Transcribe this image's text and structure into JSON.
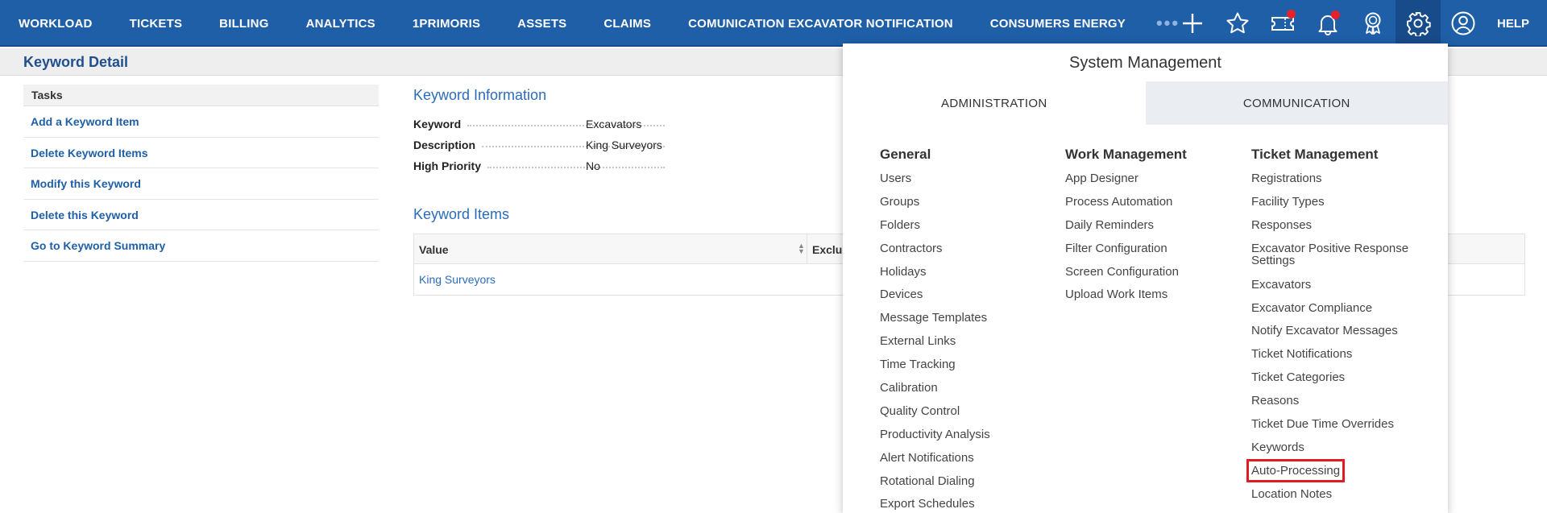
{
  "topnav": {
    "items": [
      "WORKLOAD",
      "TICKETS",
      "BILLING",
      "ANALYTICS",
      "1PRIMORIS",
      "ASSETS",
      "CLAIMS",
      "COMUNICATION EXCAVATOR NOTIFICATION",
      "CONSUMERS ENERGY"
    ],
    "more": "•••",
    "help": "HELP",
    "icons": [
      "plus-icon",
      "star-icon",
      "ticket-icon",
      "bell-icon",
      "award-icon",
      "gear-icon",
      "user-icon"
    ],
    "colors": {
      "bar": "#1f5fa8",
      "badge": "#e8202a"
    }
  },
  "page": {
    "title": "Keyword Detail"
  },
  "tasks": {
    "header": "Tasks",
    "links": [
      "Add a Keyword Item",
      "Delete Keyword Items",
      "Modify this Keyword",
      "Delete this Keyword",
      "Go to Keyword Summary"
    ]
  },
  "keyword_info": {
    "title": "Keyword Information",
    "rows": [
      {
        "label": "Keyword",
        "value": "Excavators"
      },
      {
        "label": "Description",
        "value": "King Surveyors"
      },
      {
        "label": "High Priority",
        "value": "No"
      }
    ]
  },
  "keyword_items": {
    "title": "Keyword Items",
    "columns": [
      "Value",
      "Exclus"
    ],
    "rows": [
      {
        "value": "King Surveyors"
      }
    ]
  },
  "system_management": {
    "title": "System Management",
    "tabs": [
      {
        "label": "ADMINISTRATION",
        "active": true
      },
      {
        "label": "COMMUNICATION",
        "active": false
      }
    ],
    "columns": [
      {
        "heading": "General",
        "links": [
          "Users",
          "Groups",
          "Folders",
          "Contractors",
          "Holidays",
          "Devices",
          "Message Templates",
          "External Links",
          "Time Tracking",
          "Calibration",
          "Quality Control",
          "Productivity Analysis",
          "Alert Notifications",
          "Rotational Dialing",
          "Export Schedules"
        ]
      },
      {
        "heading": "Work Management",
        "links": [
          "App Designer",
          "Process Automation",
          "Daily Reminders",
          "Filter Configuration",
          "Screen Configuration",
          "Upload Work Items"
        ]
      },
      {
        "heading": "Ticket Management",
        "links": [
          "Registrations",
          "Facility Types",
          "Responses",
          "Excavator Positive Response Settings",
          "Excavators",
          "Excavator Compliance",
          "Notify Excavator Messages",
          "Ticket Notifications",
          "Ticket Categories",
          "Reasons",
          "Ticket Due Time Overrides",
          "Keywords",
          "Auto-Processing",
          "Location Notes"
        ],
        "highlighted": "Auto-Processing",
        "highlight_color": "#e11b22"
      }
    ]
  }
}
